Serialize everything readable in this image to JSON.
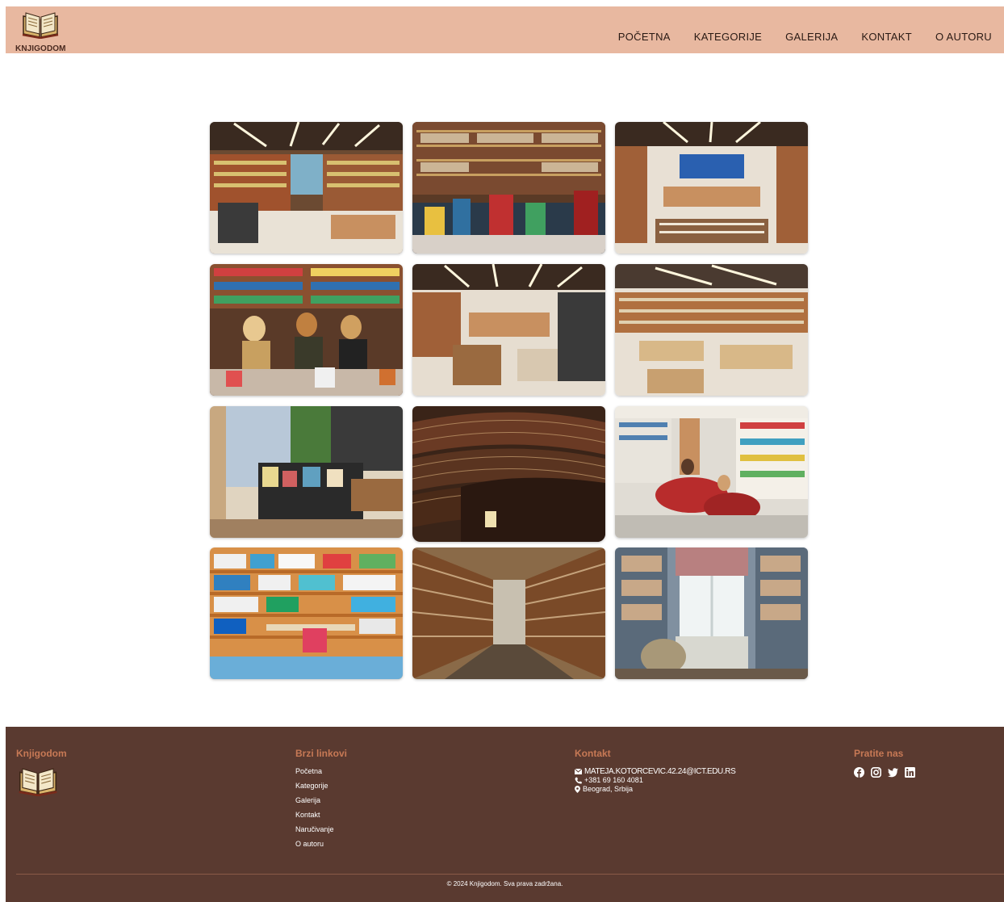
{
  "header": {
    "logo_text": "KNJIGODOM",
    "nav": [
      "POČETNA",
      "KATEGORIJE",
      "GALERIJA",
      "KONTAKT",
      "O AUTORU"
    ]
  },
  "gallery": {
    "images": [
      {
        "icon": "bookstore-interior-photo"
      },
      {
        "icon": "book-display-table-photo"
      },
      {
        "icon": "bookstore-aisles-photo"
      },
      {
        "icon": "shoppers-browsing-photo"
      },
      {
        "icon": "bookstore-hall-photo"
      },
      {
        "icon": "bookstore-tables-photo"
      },
      {
        "icon": "bookstore-entrance-photo"
      },
      {
        "icon": "round-library-photo"
      },
      {
        "icon": "reading-lounge-photo"
      },
      {
        "icon": "colorful-shelves-photo"
      },
      {
        "icon": "library-corridor-photo"
      },
      {
        "icon": "window-reading-nook-photo"
      }
    ]
  },
  "footer": {
    "brand": "Knjigodom",
    "quick_links_title": "Brzi linkovi",
    "quick_links": [
      "Početna",
      "Kategorije",
      "Galerija",
      "Kontakt",
      "Naručivanje",
      "O autoru"
    ],
    "contact_title": "Kontakt",
    "email": "MATEJA.KOTORCEVIC.42.24@ICT.EDU.RS",
    "phone": "+381 69 160 4081",
    "address": "Beograd, Srbija",
    "follow_title": "Pratite nas",
    "social": [
      "facebook-icon",
      "instagram-icon",
      "twitter-icon",
      "linkedin-icon"
    ],
    "copyright": "© 2024 Knjigodom. Sva prava zadržana."
  },
  "colors": {
    "header_bg": "#e8b8a0",
    "footer_bg": "#5a3a30",
    "footer_heading": "#c77955"
  }
}
